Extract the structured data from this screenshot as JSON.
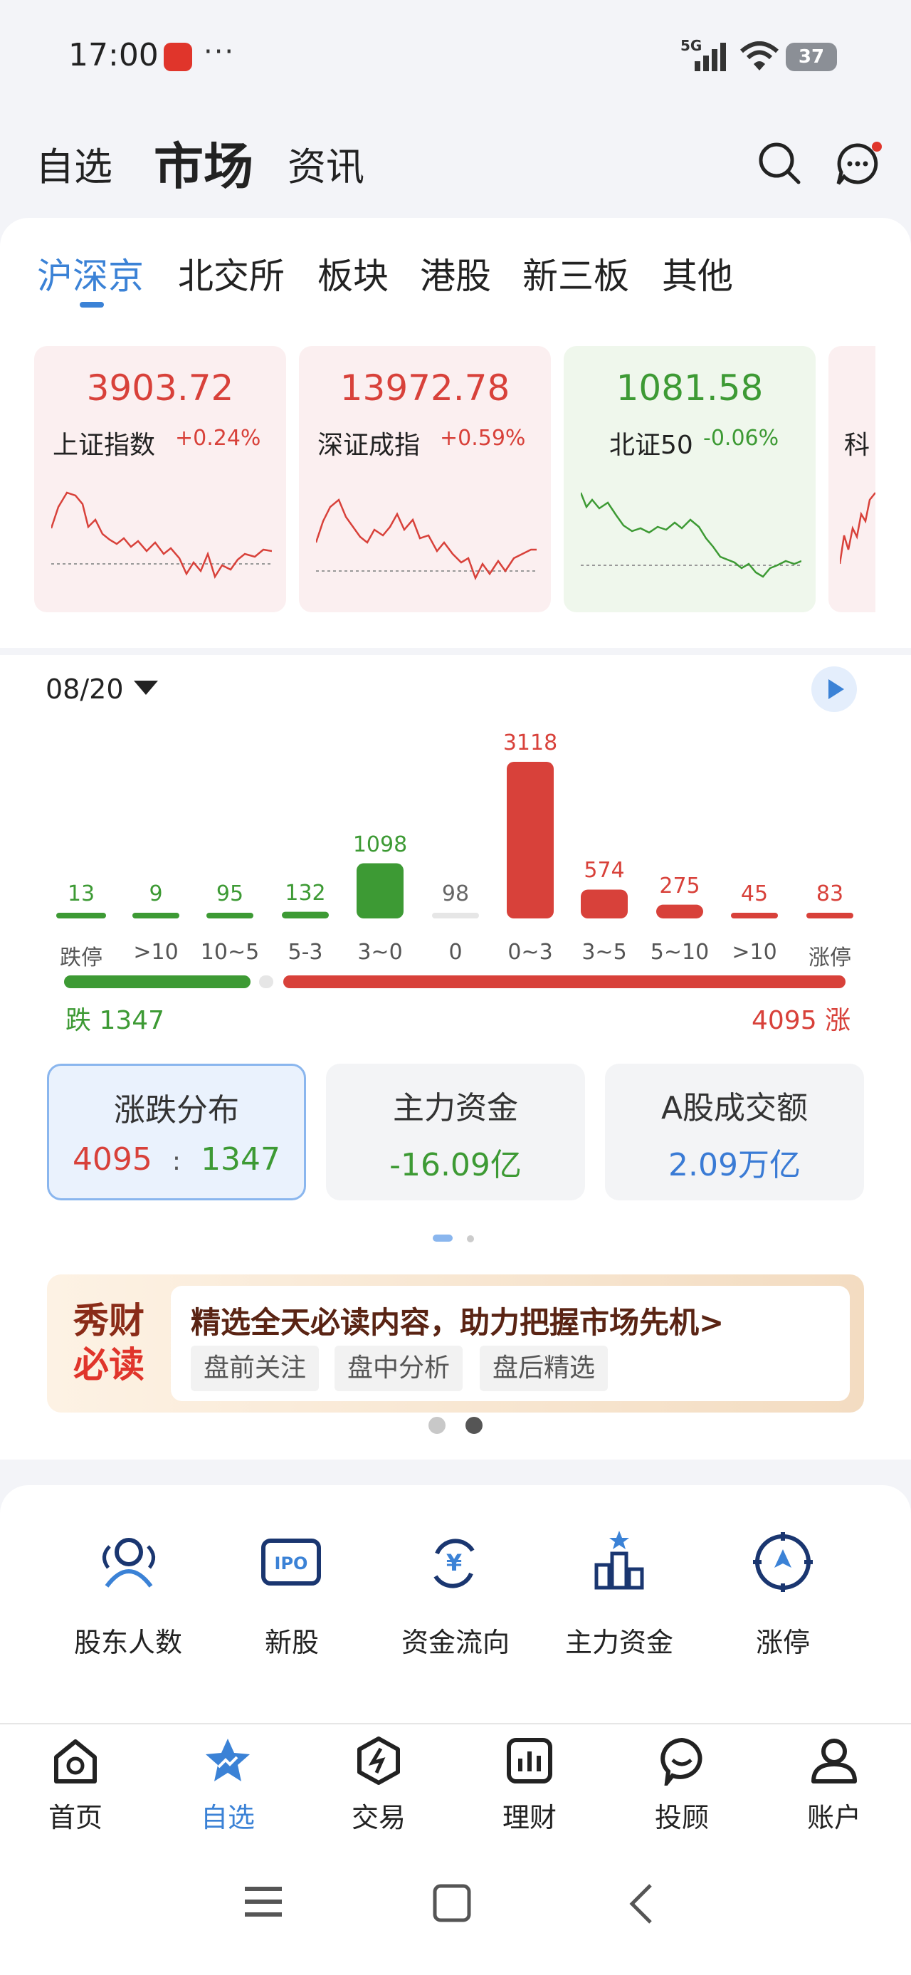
{
  "status_bar": {
    "time": "17:00",
    "dots": "···",
    "network": "5G",
    "battery": "37"
  },
  "top_tabs": [
    "自选",
    "市场",
    "资讯"
  ],
  "market_tabs": [
    "沪深京",
    "北交所",
    "板块",
    "港股",
    "新三板",
    "其他"
  ],
  "indices": [
    {
      "value": "3903.72",
      "name": "上证指数",
      "change": "+0.24%"
    },
    {
      "value": "13972.78",
      "name": "深证成指",
      "change": "+0.59%"
    },
    {
      "value": "1081.58",
      "name": "北证50",
      "change": "-0.06%"
    },
    {
      "name": "科"
    }
  ],
  "date": "08/20",
  "chart_data": {
    "type": "bar",
    "categories": [
      "跌停",
      ">10",
      "10~5",
      "5-3",
      "3~0",
      "0",
      "0~3",
      "3~5",
      "5~10",
      ">10",
      "涨停"
    ],
    "values": [
      13,
      9,
      95,
      132,
      1098,
      98,
      3118,
      574,
      275,
      45,
      83
    ]
  },
  "breadth": {
    "down_label": "跌",
    "down": "1347",
    "up": "4095",
    "up_label": "涨",
    "down_ratio": 0.248
  },
  "stat_cards": [
    {
      "title": "涨跌分布",
      "up": "4095",
      "sep": ":",
      "down": "1347"
    },
    {
      "title": "主力资金",
      "value": "-16.09亿"
    },
    {
      "title": "A股成交额",
      "value": "2.09万亿"
    }
  ],
  "banner": {
    "logo_top": "秀财",
    "logo_bottom": "必读",
    "headline": "精选全天必读内容，助力把握市场先机>",
    "chips": [
      "盘前关注",
      "盘中分析",
      "盘后精选"
    ]
  },
  "tools": [
    "股东人数",
    "新股",
    "资金流向",
    "主力资金",
    "涨停"
  ],
  "tool_icons": {
    "ipo_text": "IPO",
    "yen": "¥"
  },
  "bottom_nav": [
    {
      "label": "首页",
      "icon": "home-icon"
    },
    {
      "label": "自选",
      "icon": "star-icon"
    },
    {
      "label": "交易",
      "icon": "trade-icon"
    },
    {
      "label": "理财",
      "icon": "finance-icon"
    },
    {
      "label": "投顾",
      "icon": "advisor-icon"
    },
    {
      "label": "账户",
      "icon": "account-icon"
    }
  ],
  "colors": {
    "up": "#d8413a",
    "down": "#3d9a34",
    "accent": "#3b82d6"
  }
}
